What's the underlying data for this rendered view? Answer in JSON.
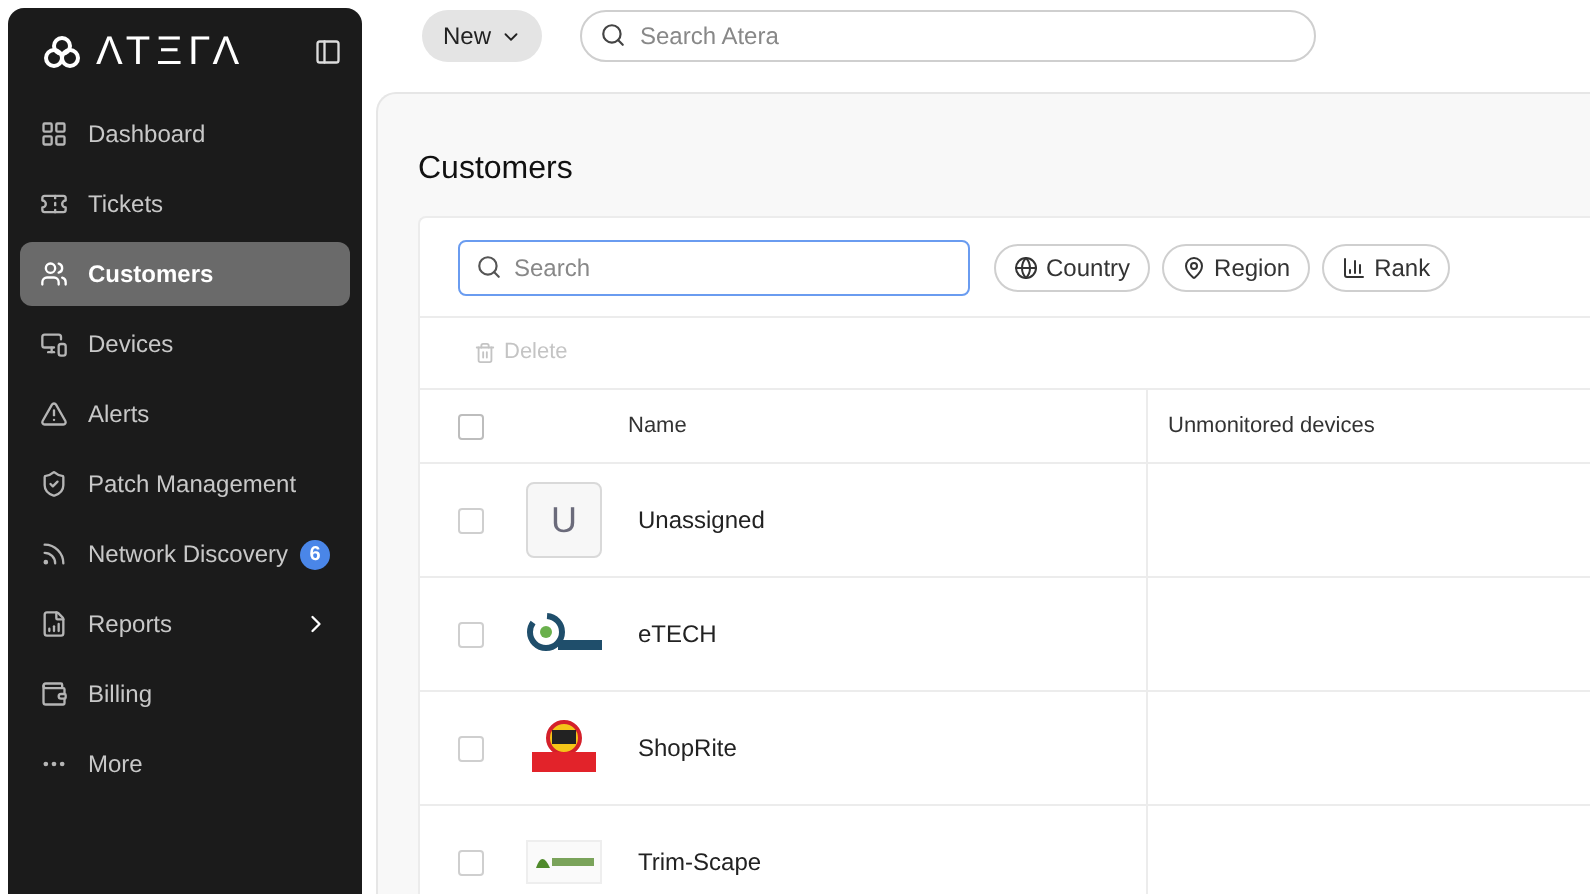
{
  "sidebar": {
    "logo": "ΛΤΞΓΛ",
    "items": [
      {
        "label": "Dashboard",
        "selected": false
      },
      {
        "label": "Tickets",
        "selected": false
      },
      {
        "label": "Customers",
        "selected": true
      },
      {
        "label": "Devices",
        "selected": false
      },
      {
        "label": "Alerts",
        "selected": false
      },
      {
        "label": "Patch Management",
        "selected": false
      },
      {
        "label": "Network Discovery",
        "selected": false,
        "badge": "6"
      },
      {
        "label": "Reports",
        "selected": false,
        "expandable": true
      },
      {
        "label": "Billing",
        "selected": false
      },
      {
        "label": "More",
        "selected": false
      }
    ]
  },
  "topbar": {
    "new_button": "New",
    "search": {
      "placeholder": "Search Atera"
    }
  },
  "page": {
    "title": "Customers",
    "search": {
      "placeholder": "Search"
    },
    "filters": [
      {
        "label": "Country"
      },
      {
        "label": "Region"
      },
      {
        "label": "Rank"
      }
    ],
    "delete_button": {
      "label": "Delete",
      "disabled": true
    },
    "table": {
      "columns": [
        "Name",
        "Unmonitored devices"
      ],
      "select_all_checked": false,
      "rows": [
        {
          "name": "Unassigned",
          "kind": "initial",
          "initial": "U",
          "checked": false
        },
        {
          "name": "eTECH",
          "kind": "ring",
          "checked": false
        },
        {
          "name": "ShopRite",
          "kind": "badge",
          "checked": false
        },
        {
          "name": "Trim-Scape",
          "kind": "leaf",
          "checked": false
        }
      ]
    }
  }
}
